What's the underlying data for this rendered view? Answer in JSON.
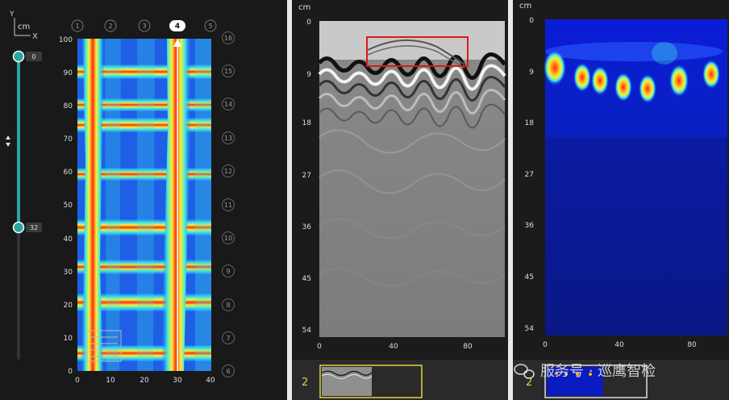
{
  "colors": {
    "accent": "#2aa6a0",
    "highlight_box": "#e01818",
    "thumb_box": "#e3d13a",
    "watermark": "#d9d9d9"
  },
  "panel_plan": {
    "axis_icon": {
      "y": "Y",
      "unit": "cm",
      "x": "X"
    },
    "slider": {
      "top_value": "0",
      "bottom_value": "32"
    },
    "y_ticks": [
      "0",
      "10",
      "20",
      "30",
      "40",
      "50",
      "60",
      "70",
      "80",
      "90",
      "100"
    ],
    "x_ticks": [
      "0",
      "10",
      "20",
      "30",
      "40"
    ],
    "top_channels": [
      "1",
      "2",
      "3",
      "4",
      "5"
    ],
    "active_channel": "4",
    "side_channels": [
      "16",
      "15",
      "14",
      "13",
      "12",
      "11",
      "10",
      "9",
      "8",
      "7",
      "6"
    ]
  },
  "panel_radar": {
    "unit": "cm",
    "y_ticks": [
      "0",
      "9",
      "18",
      "27",
      "36",
      "45",
      "54"
    ],
    "x_ticks": [
      "0",
      "40",
      "80"
    ],
    "thumb_label": "2"
  },
  "panel_migrated": {
    "unit": "cm",
    "y_ticks": [
      "0",
      "9",
      "18",
      "27",
      "36",
      "45",
      "54"
    ],
    "x_ticks": [
      "0",
      "40",
      "80"
    ],
    "thumb_label": "2"
  },
  "watermark": {
    "icon": "wechat-icon",
    "text": "服务号 · 巡鹰智检"
  }
}
